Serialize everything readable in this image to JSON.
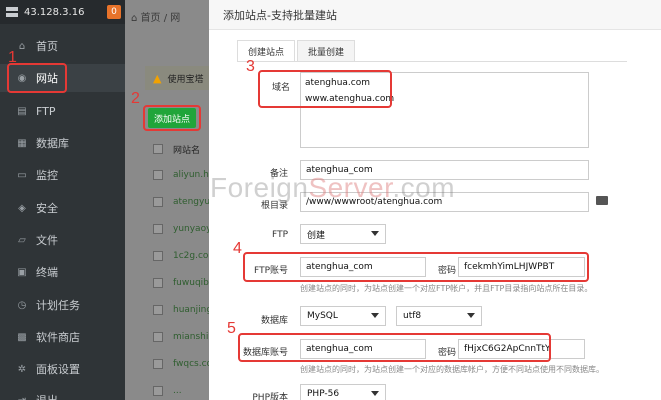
{
  "sidebar": {
    "ip": "43.128.3.16",
    "badge": "0",
    "items": [
      {
        "label": "首页",
        "icon": "home-icon"
      },
      {
        "label": "网站",
        "icon": "globe-icon"
      },
      {
        "label": "FTP",
        "icon": "ftp-icon"
      },
      {
        "label": "数据库",
        "icon": "database-icon"
      },
      {
        "label": "监控",
        "icon": "monitor-icon"
      },
      {
        "label": "安全",
        "icon": "shield-icon"
      },
      {
        "label": "文件",
        "icon": "folder-icon"
      },
      {
        "label": "终端",
        "icon": "terminal-icon"
      },
      {
        "label": "计划任务",
        "icon": "clock-icon"
      },
      {
        "label": "软件商店",
        "icon": "store-icon"
      },
      {
        "label": "面板设置",
        "icon": "gear-icon"
      },
      {
        "label": "退出",
        "icon": "logout-icon"
      }
    ]
  },
  "main": {
    "breadcrumb_home": "首页",
    "breadcrumb_current": "网",
    "warning": "使用宝塔",
    "add_site_label": "添加站点",
    "table_header": "网站名",
    "rows": [
      "aliyun.hu",
      "atengyu",
      "yunyaoy",
      "1c2g.co",
      "fuwuqib",
      "huanjing",
      "mianshi",
      "fwqcs.co",
      "..."
    ]
  },
  "modal": {
    "title": "添加站点-支持批量建站",
    "tabs": [
      "创建站点",
      "批量创建"
    ],
    "domain_label": "域名",
    "domains": [
      "atenghua.com",
      "www.atenghua.com"
    ],
    "remark_label": "备注",
    "remark_value": "atenghua_com",
    "root_label": "根目录",
    "root_value": "/www/wwwroot/atenghua.com",
    "ftp_label": "FTP",
    "ftp_select": "创建",
    "ftp_account_label": "FTP账号",
    "ftp_account_value": "atenghua_com",
    "password_label": "密码",
    "ftp_password_value": "fcekmhYimLHJWPBT",
    "ftp_hint": "创建站点的同时，为站点创建一个对应FTP帐户，并且FTP目录指向站点所在目录。",
    "db_label": "数据库",
    "db_type": "MySQL",
    "db_charset": "utf8",
    "db_account_label": "数据库账号",
    "db_account_value": "atenghua_com",
    "db_password_value": "fHjxC6G2ApCnnTtY",
    "db_hint": "创建站点的同时，为站点创建一个对应的数据库帐户，方便不同站点使用不同数据库。",
    "php_label": "PHP版本",
    "php_value": "PHP-56"
  },
  "annotations": {
    "n1": "1",
    "n2": "2",
    "n3": "3",
    "n4": "4",
    "n5": "5",
    "color": "#e53935"
  },
  "watermark": {
    "prefix": "Foreign",
    "accent": "Server",
    "suffix": ".com"
  },
  "colors": {
    "sidebar_bg": "#2f3437",
    "add_button": "#20a53a",
    "badge": "#e8732a"
  }
}
